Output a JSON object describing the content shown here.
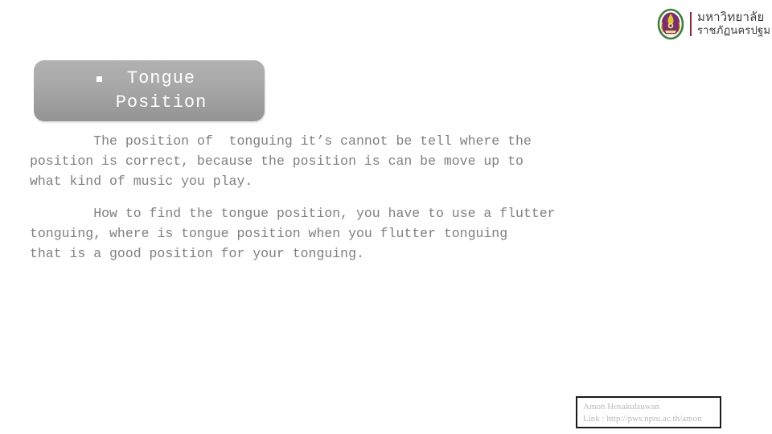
{
  "logo": {
    "seal_icon": "university-seal-icon",
    "name_line1": "มหาวิทยาลัย",
    "name_line2": "ราชภัฏนครปฐม",
    "seal_colors": {
      "ring": "#3f7c3f",
      "field": "#7a2f6a",
      "emblem": "#e0c23a",
      "divider": "#8c2b34"
    }
  },
  "title": {
    "bullet": "▪",
    "line1": "Tongue",
    "line2": "Position",
    "text_color": "#ffffff",
    "plaque_gradient_from": "#b2b2b2",
    "plaque_gradient_to": "#949494"
  },
  "body": {
    "text_color": "#808080",
    "paragraphs": [
      "        The position of  tonguing it’s cannot be tell where the\nposition is correct, because the position is can be move up to\nwhat kind of music you play.",
      "        How to find the tongue position, you have to use a flutter\ntonguing, where is tongue position when you flutter tonguing\nthat is a good position for your tonguing."
    ]
  },
  "credit": {
    "author": "Amon Hosakulsuwan",
    "link": "Link : http://pws.npru.ac.th/amon",
    "border_color": "#1a1a1a",
    "text_color": "#b8b8b8"
  }
}
